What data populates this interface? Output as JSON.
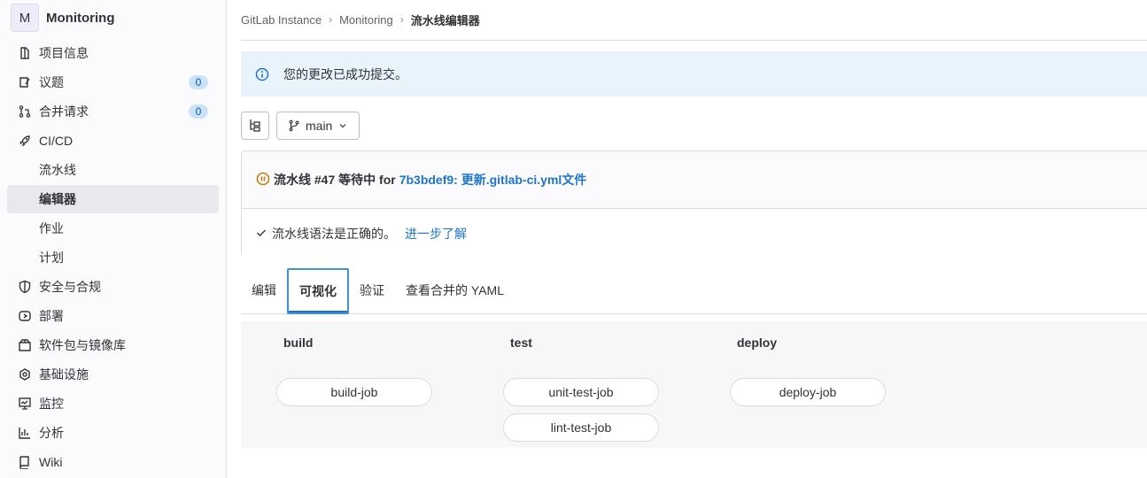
{
  "project": {
    "avatar_letter": "M",
    "name": "Monitoring"
  },
  "sidebar": {
    "items": [
      {
        "label": "项目信息",
        "icon": "project-icon"
      },
      {
        "label": "议题",
        "icon": "issues-icon",
        "badge": "0"
      },
      {
        "label": "合并请求",
        "icon": "merge-request-icon",
        "badge": "0"
      },
      {
        "label": "CI/CD",
        "icon": "rocket-icon"
      },
      {
        "label": "流水线"
      },
      {
        "label": "编辑器",
        "active": true
      },
      {
        "label": "作业"
      },
      {
        "label": "计划"
      },
      {
        "label": "安全与合规",
        "icon": "shield-icon"
      },
      {
        "label": "部署",
        "icon": "deployments-icon"
      },
      {
        "label": "软件包与镜像库",
        "icon": "package-icon"
      },
      {
        "label": "基础设施",
        "icon": "cloud-gear-icon"
      },
      {
        "label": "监控",
        "icon": "monitor-icon"
      },
      {
        "label": "分析",
        "icon": "chart-icon"
      },
      {
        "label": "Wiki",
        "icon": "book-icon"
      }
    ]
  },
  "breadcrumb": {
    "root": "GitLab Instance",
    "project": "Monitoring",
    "current": "流水线编辑器"
  },
  "alert": {
    "text": "您的更改已成功提交。"
  },
  "toolbar": {
    "branch": "main"
  },
  "pipeline_status": {
    "prefix": "流水线 #47 等待中 for",
    "commit_link": "7b3bdef9: 更新.gitlab-ci.yml文件",
    "syntax_text": "流水线语法是正确的。",
    "learn_more": "进一步了解"
  },
  "tabs": [
    {
      "label": "编辑"
    },
    {
      "label": "可视化",
      "active": true
    },
    {
      "label": "验证"
    },
    {
      "label": "查看合并的 YAML"
    }
  ],
  "stages": [
    {
      "name": "build",
      "jobs": [
        "build-job"
      ]
    },
    {
      "name": "test",
      "jobs": [
        "unit-test-job",
        "lint-test-job"
      ]
    },
    {
      "name": "deploy",
      "jobs": [
        "deploy-job"
      ]
    }
  ],
  "colors": {
    "link": "#1f75cb",
    "alert_bg": "#e9f3fc",
    "badge_bg": "#cbe2f9",
    "pending": "#c17d10"
  }
}
